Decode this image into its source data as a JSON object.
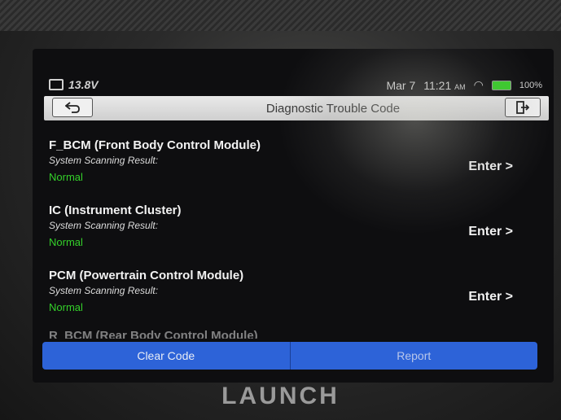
{
  "status": {
    "voltage": "13.8V",
    "date": "Mar 7",
    "time": "11:21",
    "ampm": "AM",
    "battery_percent": "100%",
    "battery_color": "#39d12a"
  },
  "titlebar": {
    "title": "Diagnostic Trouble Code",
    "back_icon": "back-arrow-icon",
    "exit_icon": "exit-icon"
  },
  "modules": [
    {
      "name": "F_BCM (Front Body Control Module)",
      "scan_label": "System Scanning Result:",
      "result": "Normal",
      "enter": "Enter >"
    },
    {
      "name": "IC (Instrument Cluster)",
      "scan_label": "System Scanning Result:",
      "result": "Normal",
      "enter": "Enter >"
    },
    {
      "name": "PCM (Powertrain Control Module)",
      "scan_label": "System Scanning Result:",
      "result": "Normal",
      "enter": "Enter >"
    },
    {
      "name": "R_BCM (Rear Body Control Module)"
    }
  ],
  "buttons": {
    "clear": "Clear Code",
    "report": "Report"
  },
  "brand": "LAUNCH",
  "colors": {
    "accent_blue": "#2d63d8",
    "normal_green": "#34d12a"
  }
}
